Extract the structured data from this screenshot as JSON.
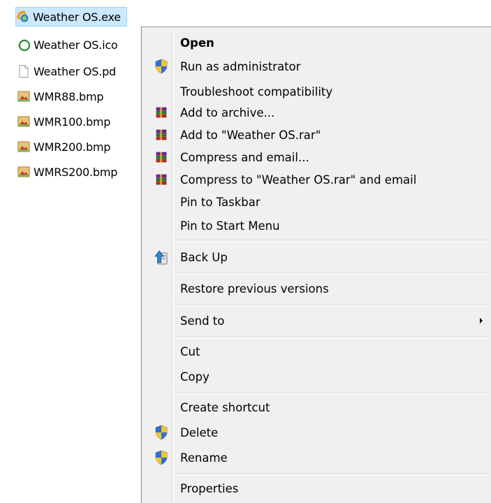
{
  "files": [
    {
      "name": "Weather OS.exe",
      "icon": "weather-os-app-icon",
      "selected": true
    },
    {
      "name": "Weather OS.ico",
      "icon": "weather-os-ico-icon",
      "selected": false
    },
    {
      "name": "Weather OS.pd",
      "icon": "blank-file-icon",
      "selected": false
    },
    {
      "name": "WMR88.bmp",
      "icon": "bitmap-image-icon",
      "selected": false
    },
    {
      "name": "WMR100.bmp",
      "icon": "bitmap-image-icon",
      "selected": false
    },
    {
      "name": "WMR200.bmp",
      "icon": "bitmap-image-icon",
      "selected": false
    },
    {
      "name": "WMRS200.bmp",
      "icon": "bitmap-image-icon",
      "selected": false
    }
  ],
  "context_menu": {
    "items": [
      {
        "label": "Open",
        "icon": "",
        "bold": true
      },
      {
        "label": "Run as administrator",
        "icon": "uac-shield-icon"
      },
      {
        "label": "Troubleshoot compatibility",
        "icon": ""
      },
      {
        "label": "Add to archive...",
        "icon": "winrar-books-icon"
      },
      {
        "label": "Add to \"Weather OS.rar\"",
        "icon": "winrar-books-icon"
      },
      {
        "label": "Compress and email...",
        "icon": "winrar-books-icon"
      },
      {
        "label": "Compress to \"Weather OS.rar\" and email",
        "icon": "winrar-books-icon"
      },
      {
        "label": "Pin to Taskbar",
        "icon": ""
      },
      {
        "label": "Pin to Start Menu",
        "icon": ""
      },
      {
        "label": "Back Up",
        "icon": "backup-arrow-icon"
      },
      {
        "label": "Restore previous versions",
        "icon": ""
      },
      {
        "label": "Send to",
        "icon": "",
        "submenu": true
      },
      {
        "label": "Cut",
        "icon": ""
      },
      {
        "label": "Copy",
        "icon": ""
      },
      {
        "label": "Create shortcut",
        "icon": ""
      },
      {
        "label": "Delete",
        "icon": "uac-shield-icon"
      },
      {
        "label": "Rename",
        "icon": "uac-shield-icon"
      },
      {
        "label": "Properties",
        "icon": ""
      }
    ]
  },
  "colors": {
    "selection_bg": "#cce8ff",
    "selection_border": "#99d1ff",
    "menu_bg": "#f0f0f0",
    "menu_border": "#979797"
  }
}
